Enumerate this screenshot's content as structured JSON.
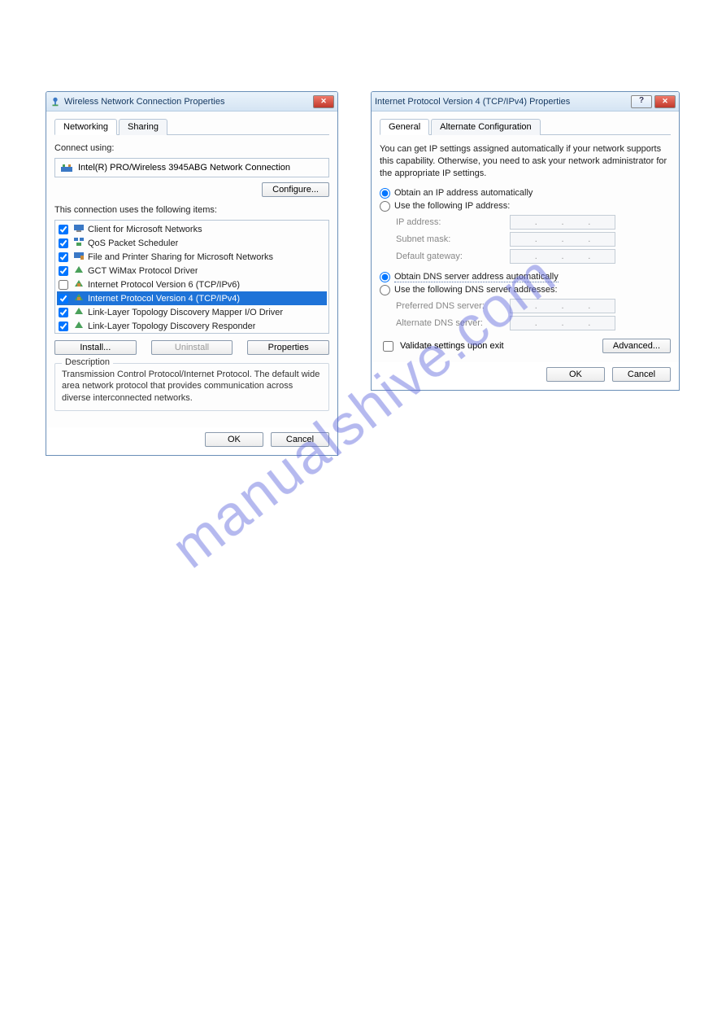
{
  "watermark": "manualshive.com",
  "dialog1": {
    "title": "Wireless Network Connection Properties",
    "tabs": [
      "Networking",
      "Sharing"
    ],
    "active_tab": 0,
    "connect_using_label": "Connect using:",
    "adapter_name": "Intel(R) PRO/Wireless 3945ABG Network Connection",
    "configure_btn": "Configure...",
    "items_label": "This connection uses the following items:",
    "items": [
      {
        "checked": true,
        "icon": "client-icon",
        "text": "Client for Microsoft Networks"
      },
      {
        "checked": true,
        "icon": "qos-icon",
        "text": "QoS Packet Scheduler"
      },
      {
        "checked": true,
        "icon": "share-icon",
        "text": "File and Printer Sharing for Microsoft Networks"
      },
      {
        "checked": true,
        "icon": "driver-icon",
        "text": "GCT WiMax Protocol Driver"
      },
      {
        "checked": false,
        "icon": "protocol-icon",
        "text": "Internet Protocol Version 6 (TCP/IPv6)"
      },
      {
        "checked": true,
        "icon": "protocol-icon",
        "text": "Internet Protocol Version 4 (TCP/IPv4)",
        "selected": true
      },
      {
        "checked": true,
        "icon": "driver-icon",
        "text": "Link-Layer Topology Discovery Mapper I/O Driver"
      },
      {
        "checked": true,
        "icon": "driver-icon",
        "text": "Link-Layer Topology Discovery Responder"
      }
    ],
    "install_btn": "Install...",
    "uninstall_btn": "Uninstall",
    "properties_btn": "Properties",
    "desc_title": "Description",
    "desc_text": "Transmission Control Protocol/Internet Protocol. The default wide area network protocol that provides communication across diverse interconnected networks.",
    "ok_btn": "OK",
    "cancel_btn": "Cancel"
  },
  "dialog2": {
    "title": "Internet Protocol Version 4 (TCP/IPv4) Properties",
    "tabs": [
      "General",
      "Alternate Configuration"
    ],
    "active_tab": 0,
    "info_text": "You can get IP settings assigned automatically if your network supports this capability. Otherwise, you need to ask your network administrator for the appropriate IP settings.",
    "ip_auto_label": "Obtain an IP address automatically",
    "ip_manual_label": "Use the following IP address:",
    "ip_address_label": "IP address:",
    "subnet_label": "Subnet mask:",
    "gateway_label": "Default gateway:",
    "dns_auto_label": "Obtain DNS server address automatically",
    "dns_manual_label": "Use the following DNS server addresses:",
    "pref_dns_label": "Preferred DNS server:",
    "alt_dns_label": "Alternate DNS server:",
    "validate_label": "Validate settings upon exit",
    "advanced_btn": "Advanced...",
    "ok_btn": "OK",
    "cancel_btn": "Cancel"
  }
}
